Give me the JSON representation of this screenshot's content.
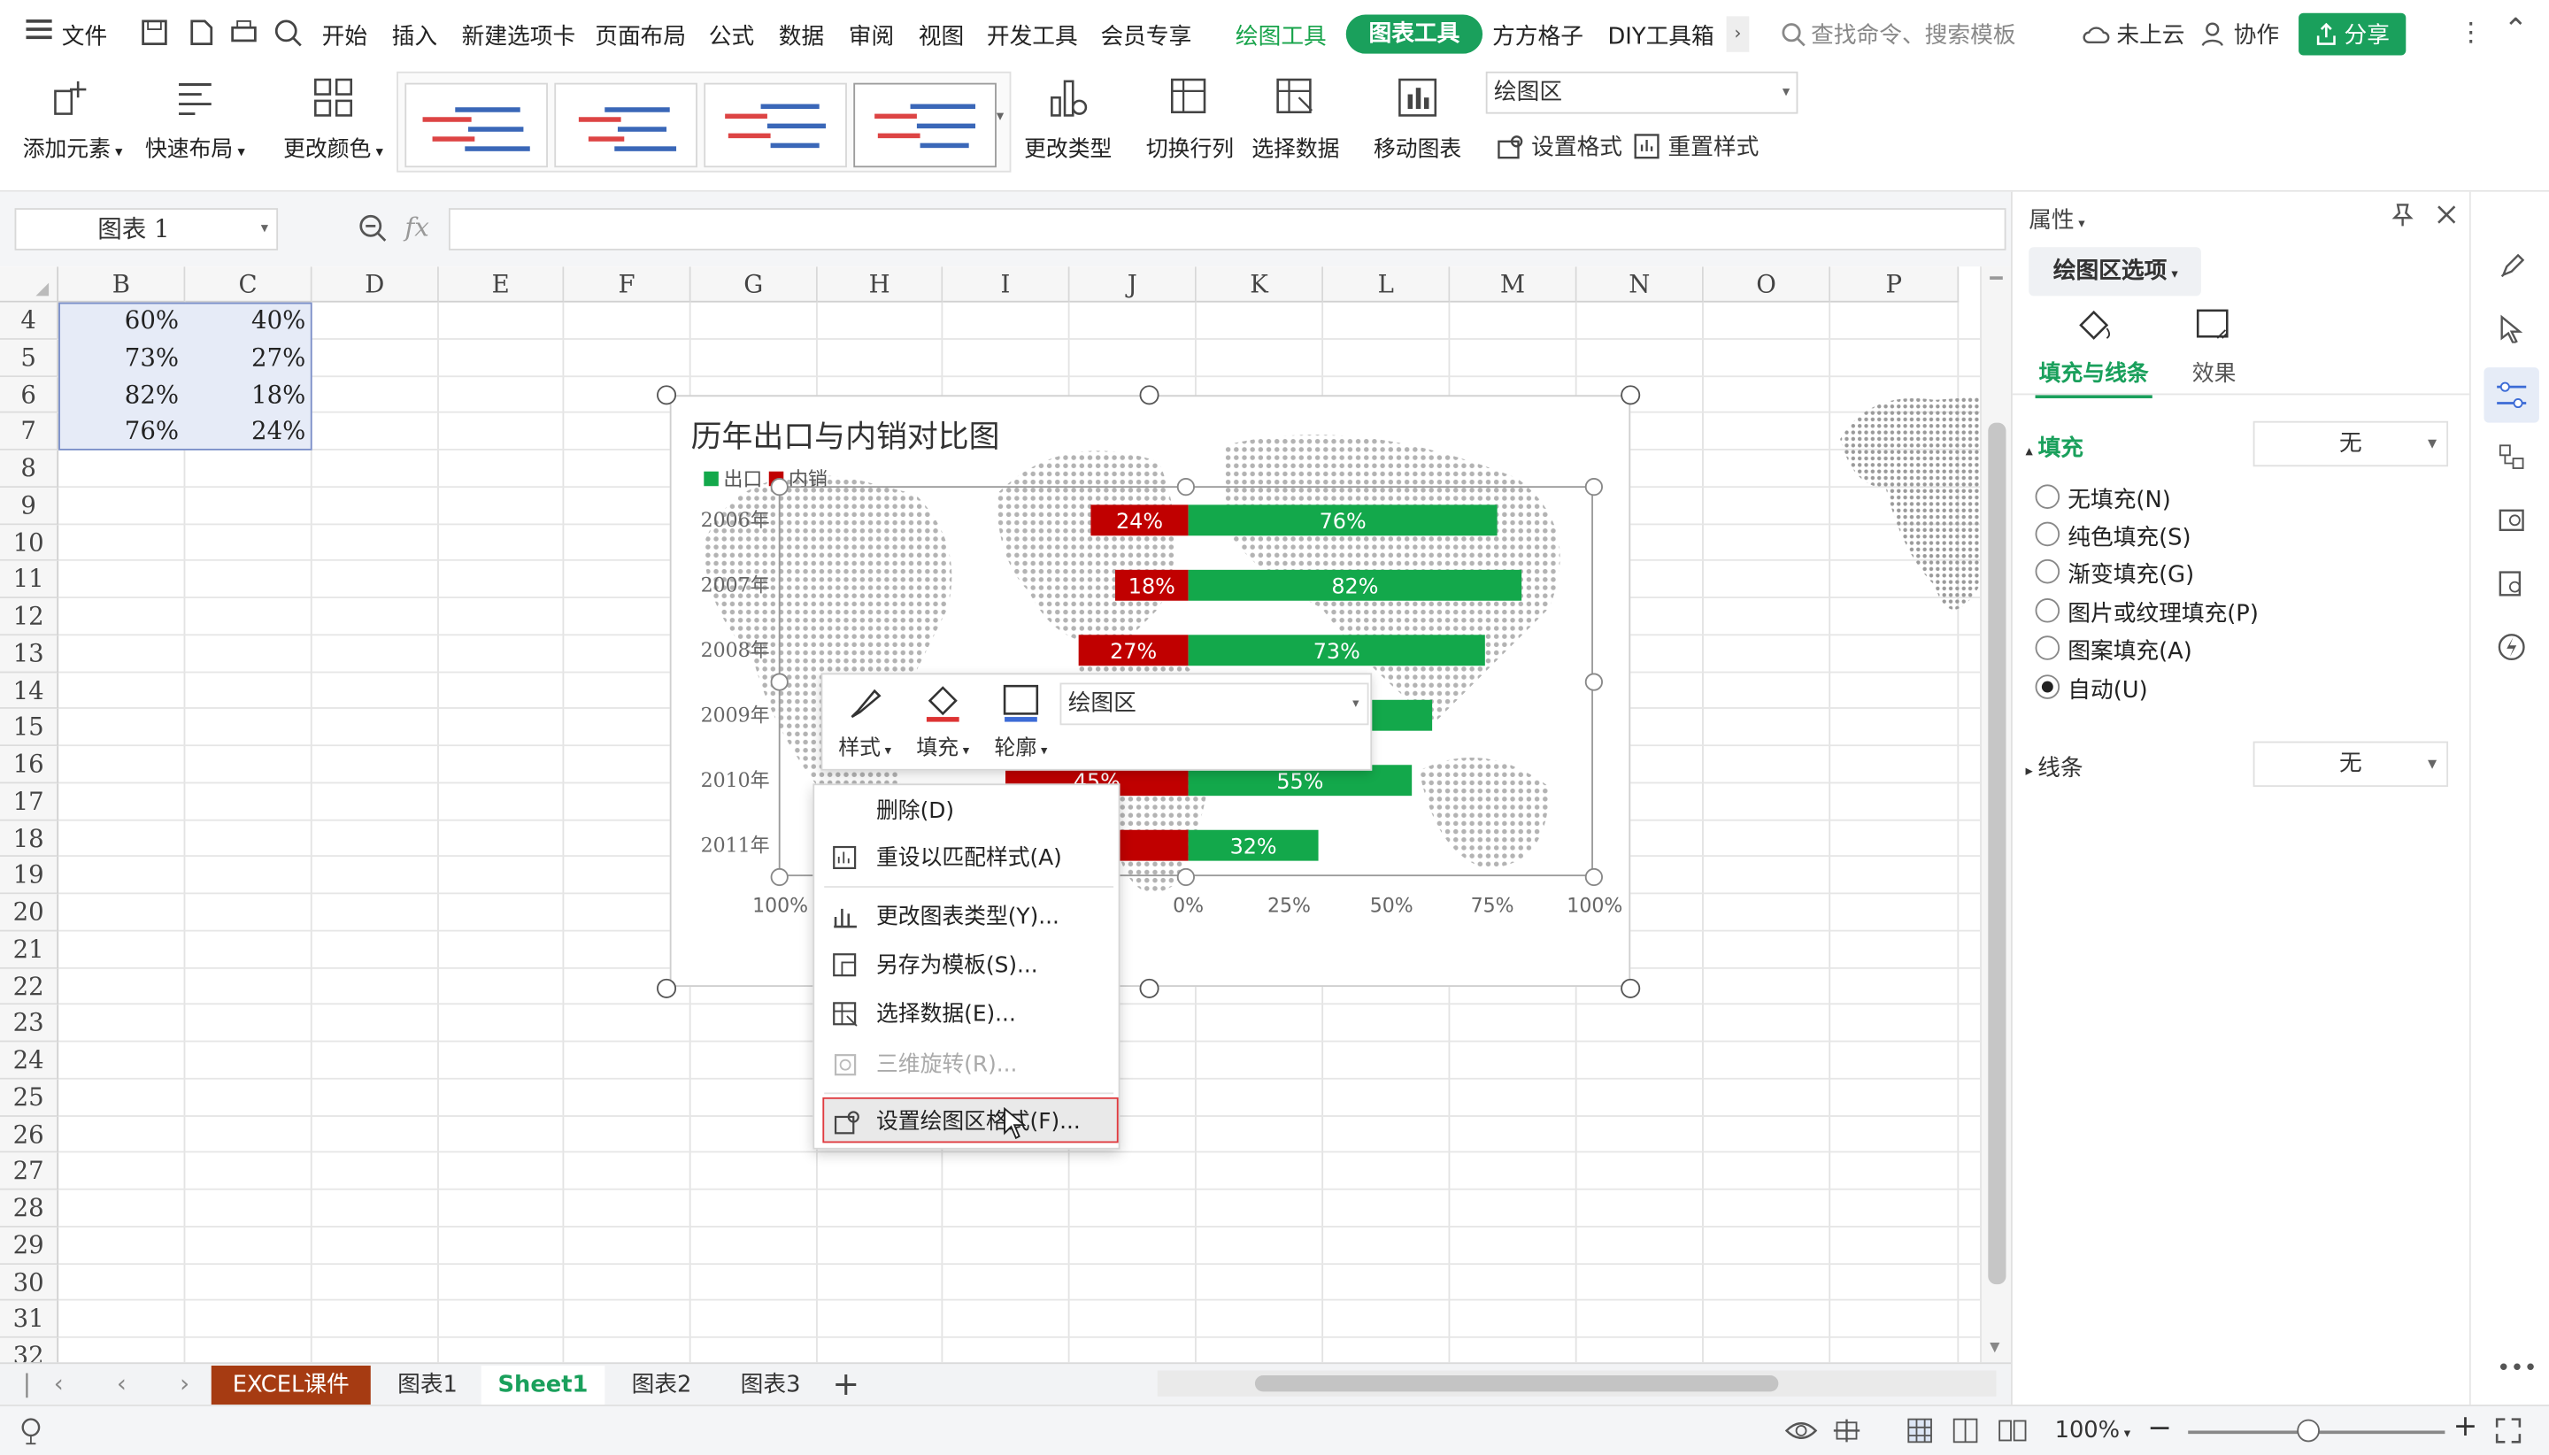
{
  "menubar": {
    "items": [
      "文件",
      "开始",
      "插入",
      "新建选项卡",
      "页面布局",
      "公式",
      "数据",
      "审阅",
      "视图",
      "开发工具",
      "会员专享",
      "绘图工具",
      "图表工具",
      "方方格子",
      "DIY工具箱"
    ],
    "search_placeholder": "查找命令、搜索模板",
    "cloud": "未上云",
    "collab": "协作",
    "share": "分享"
  },
  "ribbon": {
    "add_element": "添加元素",
    "quick_layout": "快速布局",
    "change_color": "更改颜色",
    "change_type": "更改类型",
    "switch_rowcol": "切换行列",
    "select_data": "选择数据",
    "move_chart": "移动图表",
    "area_select": "绘图区",
    "set_format": "设置格式",
    "reset_style": "重置样式"
  },
  "formula_bar": {
    "name_box": "图表 1",
    "fx": "fx"
  },
  "grid": {
    "columns": [
      "B",
      "C",
      "D",
      "E",
      "F",
      "G",
      "H",
      "I",
      "J",
      "K",
      "L",
      "M",
      "N",
      "O",
      "P"
    ],
    "rows": [
      "4",
      "5",
      "6",
      "7",
      "8",
      "9",
      "10",
      "11",
      "12",
      "13",
      "14",
      "15",
      "16",
      "17",
      "18",
      "19",
      "20",
      "21",
      "22",
      "23",
      "24",
      "25",
      "26",
      "27",
      "28",
      "29",
      "30",
      "31",
      "32"
    ],
    "data": [
      [
        "60%",
        "40%"
      ],
      [
        "73%",
        "27%"
      ],
      [
        "82%",
        "18%"
      ],
      [
        "76%",
        "24%"
      ]
    ]
  },
  "chart_data": {
    "type": "bar",
    "title": "历年出口与内销对比图",
    "legend": [
      "出口",
      "内销"
    ],
    "legend_position": "top-left",
    "categories": [
      "2006年",
      "2007年",
      "2008年",
      "2009年",
      "2010年",
      "2011年"
    ],
    "series": [
      {
        "name": "出口",
        "values": [
          76,
          82,
          73,
          60,
          55,
          32
        ],
        "color": "#13a84b"
      },
      {
        "name": "内销",
        "values": [
          24,
          18,
          27,
          40,
          45,
          68
        ],
        "color": "#c00000"
      }
    ],
    "data_labels": [
      {
        "left": "24%",
        "right": "76%"
      },
      {
        "left": "18%",
        "right": "82%"
      },
      {
        "left": "27%",
        "right": "73%"
      },
      {
        "left": "",
        "right": ""
      },
      {
        "left": "45%",
        "right": "55%"
      },
      {
        "left": "",
        "right": "32%"
      }
    ],
    "x_ticks": [
      "100%",
      "0%",
      "25%",
      "50%",
      "75%",
      "100%"
    ],
    "xlim": [
      -100,
      100
    ]
  },
  "mini_toolbar": {
    "style": "样式",
    "fill": "填充",
    "outline": "轮廓",
    "select": "绘图区"
  },
  "context_menu": {
    "delete": "删除(D)",
    "reset_style": "重设以匹配样式(A)",
    "change_type": "更改图表类型(Y)...",
    "save_template": "另存为模板(S)...",
    "select_data": "选择数据(E)...",
    "rotate3d": "三维旋转(R)...",
    "format_area": "设置绘图区格式(F)..."
  },
  "panel": {
    "title": "属性",
    "options": "绘图区选项",
    "tab_fill": "填充与线条",
    "tab_effect": "效果",
    "fill_label": "填充",
    "fill_value": "无",
    "radios": [
      "无填充(N)",
      "纯色填充(S)",
      "渐变填充(G)",
      "图片或纹理填充(P)",
      "图案填充(A)",
      "自动(U)"
    ],
    "line_label": "线条",
    "line_value": "无"
  },
  "sheets": [
    "EXCEL课件",
    "图表1",
    "Sheet1",
    "图表2",
    "图表3"
  ],
  "status": {
    "zoom": "100%"
  },
  "colors": {
    "accent": "#1aa05c",
    "export": "#13a84b",
    "domestic": "#c00000",
    "active_tab": "#a63b12"
  }
}
